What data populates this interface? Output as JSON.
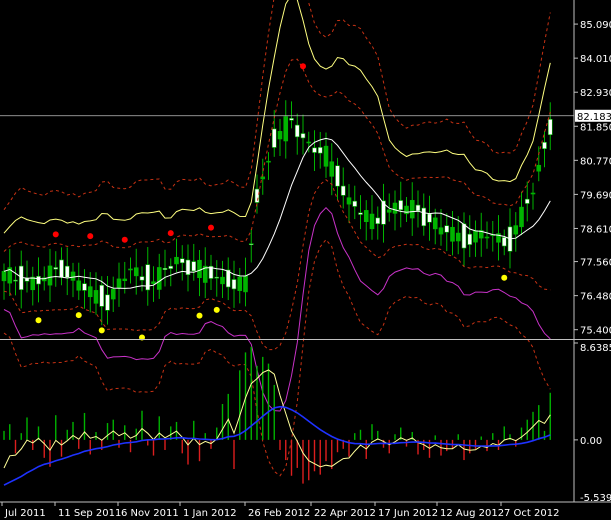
{
  "chart_data": [
    {
      "type": "candlestick",
      "title": "",
      "price_axis_labels": [
        "85.090",
        "84.010",
        "82.930",
        "81.850",
        "80.770",
        "79.690",
        "78.610",
        "77.560",
        "76.480",
        "75.400"
      ],
      "current_price_label": "82.183",
      "date_axis_labels": [
        "Jul 2011",
        "11 Sep 2011",
        "6 Nov 2011",
        "1 Jan 2012",
        "26 Feb 2012",
        "22 Apr 2012",
        "17 Jun 2012",
        "12 Aug 2012",
        "7 Oct 2012"
      ],
      "ylim": [
        75.2,
        85.6
      ],
      "overlays": [
        "bollinger-bands-inner",
        "bollinger-bands-outer",
        "moving-average",
        "lower-indicator-magenta",
        "fractals-up-red",
        "fractals-down-yellow"
      ],
      "colors": {
        "bull": "#00b400",
        "bear": "#ffffff",
        "bands_inner": "#ffffff",
        "bands_outer": "#c83214",
        "outer_line": "#ffff80",
        "magenta": "#c832c8",
        "fractal_up": "#ff0000",
        "fractal_down": "#ffff00",
        "grid_text": "#ffffff",
        "separator": "#c0c0c0"
      }
    },
    {
      "type": "histogram",
      "title": "",
      "y_axis_labels": [
        "8.6385",
        "0.00",
        "-5.5395"
      ],
      "ylim": [
        -5.5395,
        8.6385
      ],
      "series": [
        {
          "values": [
            0.8,
            1.4,
            -1.2,
            0.6,
            2.0,
            -0.9,
            1.2,
            -1.6,
            -2.4,
            2.2,
            -1.5,
            0.9,
            1.6,
            -0.8,
            2.4,
            -1.3,
            0.7,
            -0.9,
            1.5,
            1.8,
            -0.7,
            1.3,
            -1.1,
            1.0,
            2.6,
            -0.5,
            -1.4,
            2.1,
            -0.9,
            1.2,
            1.6,
            -1.2,
            -2.2,
            1.7,
            -1.9,
            0.6,
            -0.8,
            1.1,
            3.2,
            4.1,
            -2.6,
            6.2,
            7.8,
            8.3,
            6.6,
            7.4,
            6.8,
            4.9,
            -0.9,
            -1.8,
            -3.2,
            -2.5,
            -3.9,
            -3.6,
            -2.8,
            -3.1,
            -1.9,
            -2.6,
            -1.1,
            -0.8,
            -1.5,
            0.6,
            0.9,
            -1.7,
            1.4,
            0.8,
            -0.7,
            -1.2,
            0.5,
            1.1,
            -0.6,
            0.7,
            -1.3,
            -0.9,
            -1.6,
            0.4,
            -1.4,
            -1.0,
            -0.8,
            0.5,
            -1.8,
            -1.2,
            -0.8,
            0.3,
            -1.0,
            0.6,
            -0.9,
            1.2,
            0.5,
            -0.6,
            1.1,
            1.8,
            2.5,
            3.1,
            0.8,
            4.2
          ]
        }
      ]
    }
  ]
}
